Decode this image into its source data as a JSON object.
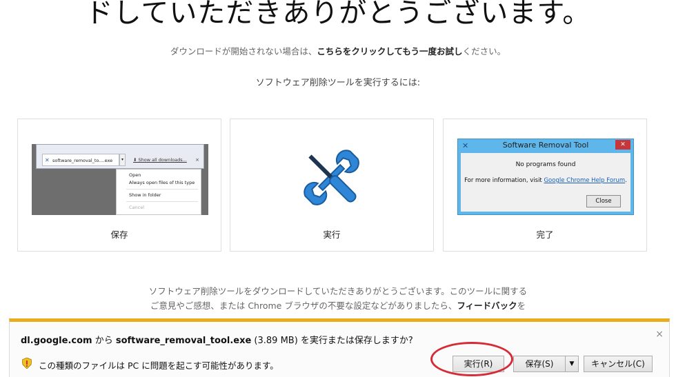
{
  "header": {
    "title": "ドしていただきありがとうございます。",
    "subline_before": "ダウンロードが開始されない場合は、",
    "subline_link": "こちらをクリックしてもう一度お試し",
    "subline_after": "ください。",
    "steps_title": "ソフトウェア削除ツールを実行するには:"
  },
  "cards": [
    {
      "label": "保存",
      "download_bar": {
        "file_name": "software_removal_to....exe",
        "show_all": "Show all downloads...",
        "close": "×",
        "menu_items": [
          "Open",
          "Always open files of this type",
          "Show in folder",
          "Cancel"
        ]
      }
    },
    {
      "label": "実行"
    },
    {
      "label": "完了",
      "dialog": {
        "title": "Software Removal Tool",
        "message": "No programs found",
        "info_before": "For more information, visit ",
        "info_link": "Google Chrome Help Forum",
        "info_after": ".",
        "close_button": "Close"
      }
    }
  ],
  "paragraph": {
    "line1": "ソフトウェア削除ツールをダウンロードしていただきありがとうございます。このツールに関する",
    "line2_before": "ご意見やご感想、または Chrome ブラウザの不要な設定などがありましたら、",
    "line2_bold": "フィードバック",
    "line2_after": "を"
  },
  "download_bar": {
    "close": "×",
    "source": "dl.google.com",
    "from": " から ",
    "file": "software_removal_tool.exe",
    "size": " (3.89 MB) ",
    "question": "を実行または保存しますか?",
    "warning": "この種類のファイルは PC に問題を起こす可能性があります。",
    "run_button": "実行(R)",
    "save_button": "保存(S)",
    "save_dropdown": "▼",
    "cancel_button": "キャンセル(C)",
    "accent_color": "#e8ad1d",
    "highlight_color": "#d62b37"
  }
}
